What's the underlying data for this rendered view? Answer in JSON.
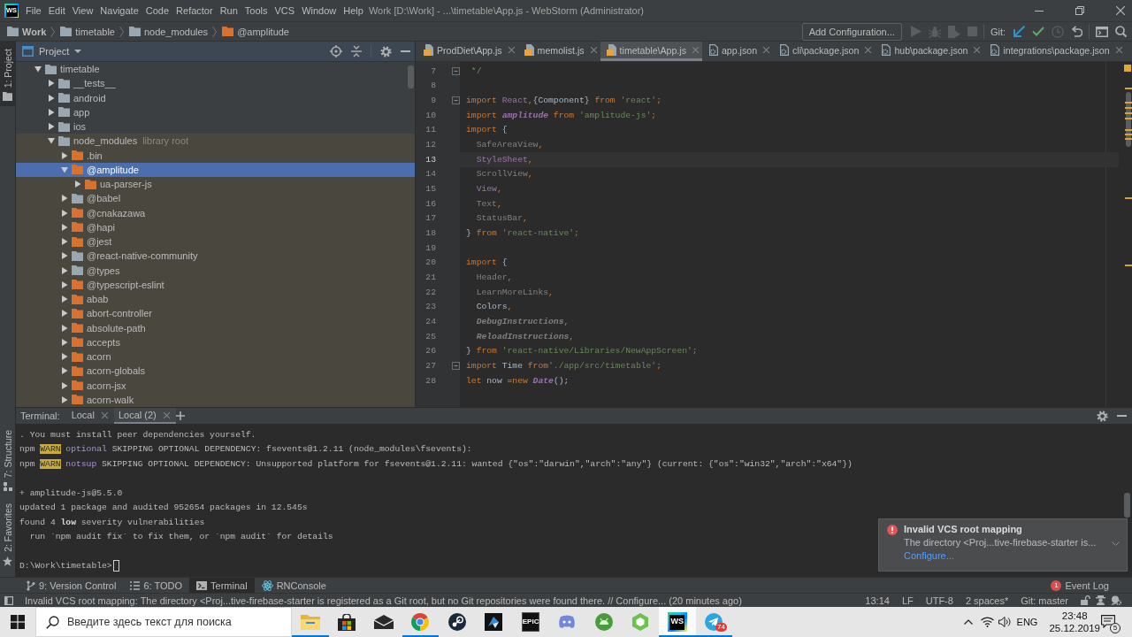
{
  "title_bar": {
    "logo_text": "WS",
    "menu": [
      "File",
      "Edit",
      "View",
      "Navigate",
      "Code",
      "Refactor",
      "Run",
      "Tools",
      "VCS",
      "Window",
      "Help"
    ],
    "title": "Work [D:\\Work] - ...\\timetable\\App.js - WebStorm (Administrator)"
  },
  "navigation_bar": {
    "breadcrumbs": [
      {
        "label": "Work",
        "kind": "project"
      },
      {
        "label": "timetable",
        "kind": "folder"
      },
      {
        "label": "node_modules",
        "kind": "folder"
      },
      {
        "label": "@amplitude",
        "kind": "package"
      }
    ],
    "run_configuration": "Add Configuration...",
    "run_tools": [
      {
        "kind": "run",
        "disabled": true
      },
      {
        "kind": "debug",
        "disabled": true
      },
      {
        "kind": "coverage",
        "disabled": true
      },
      {
        "kind": "stop",
        "disabled": true
      }
    ],
    "vcs_label": "Git:",
    "vcs_tools": [
      {
        "kind": "update",
        "disabled": false
      },
      {
        "kind": "commit",
        "disabled": false
      },
      {
        "kind": "history",
        "disabled": true
      },
      {
        "kind": "rollback",
        "disabled": false
      }
    ]
  },
  "left_stripe": {
    "top": [
      {
        "label": "1: Project",
        "kind": "project",
        "selected": true
      }
    ],
    "bottom": [
      {
        "label": "7: Structure",
        "kind": "structure",
        "selected": false
      },
      {
        "label": "2: Favorites",
        "kind": "favorites",
        "selected": false
      }
    ]
  },
  "project_panel": {
    "title": "Project",
    "tree": [
      {
        "label": "timetable",
        "kind": "folder",
        "expanded": true,
        "selected": false,
        "children": [
          {
            "label": "__tests__",
            "kind": "folder",
            "expanded": false,
            "selected": false
          },
          {
            "label": "android",
            "kind": "folder",
            "expanded": false,
            "selected": false
          },
          {
            "label": "app",
            "kind": "folder",
            "expanded": false,
            "selected": false
          },
          {
            "label": "ios",
            "kind": "folder",
            "expanded": false,
            "selected": false
          },
          {
            "label": "node_modules",
            "kind": "library-root",
            "hint": "library root",
            "expanded": true,
            "selected": false,
            "children": [
              {
                "label": ".bin",
                "kind": "package",
                "expanded": false,
                "selected": false
              },
              {
                "label": "@amplitude",
                "kind": "package",
                "expanded": true,
                "selected": true,
                "children": [
                  {
                    "label": "ua-parser-js",
                    "kind": "package",
                    "expanded": false,
                    "selected": false
                  }
                ]
              },
              {
                "label": "@babel",
                "kind": "folder",
                "expanded": false,
                "selected": false
              },
              {
                "label": "@cnakazawa",
                "kind": "package",
                "expanded": false,
                "selected": false
              },
              {
                "label": "@hapi",
                "kind": "package",
                "expanded": false,
                "selected": false
              },
              {
                "label": "@jest",
                "kind": "package",
                "expanded": false,
                "selected": false
              },
              {
                "label": "@react-native-community",
                "kind": "folder",
                "expanded": false,
                "selected": false
              },
              {
                "label": "@types",
                "kind": "folder",
                "expanded": false,
                "selected": false
              },
              {
                "label": "@typescript-eslint",
                "kind": "package",
                "expanded": false,
                "selected": false
              },
              {
                "label": "abab",
                "kind": "package",
                "expanded": false,
                "selected": false
              },
              {
                "label": "abort-controller",
                "kind": "package",
                "expanded": false,
                "selected": false
              },
              {
                "label": "absolute-path",
                "kind": "package",
                "expanded": false,
                "selected": false
              },
              {
                "label": "accepts",
                "kind": "package",
                "expanded": false,
                "selected": false
              },
              {
                "label": "acorn",
                "kind": "package",
                "expanded": false,
                "selected": false
              },
              {
                "label": "acorn-globals",
                "kind": "package",
                "expanded": false,
                "selected": false
              },
              {
                "label": "acorn-jsx",
                "kind": "package",
                "expanded": false,
                "selected": false
              },
              {
                "label": "acorn-walk",
                "kind": "package",
                "expanded": false,
                "selected": false
              }
            ]
          }
        ]
      }
    ]
  },
  "editor": {
    "tabs": [
      {
        "label": "ProdDiet\\App.js",
        "kind": "script",
        "selected": false
      },
      {
        "label": "memolist.js",
        "kind": "script",
        "selected": false
      },
      {
        "label": "timetable\\App.js",
        "kind": "script",
        "selected": true
      },
      {
        "label": "app.json",
        "kind": "json",
        "selected": false
      },
      {
        "label": "cli\\package.json",
        "kind": "json",
        "selected": false
      },
      {
        "label": "hub\\package.json",
        "kind": "json",
        "selected": false
      },
      {
        "label": "integrations\\package.json",
        "kind": "json",
        "selected": false
      }
    ],
    "lines": [
      {
        "number": "7",
        "current": false,
        "fold": true,
        "tokens": [
          {
            "text": " */",
            "kind": "comment"
          }
        ]
      },
      {
        "number": "8",
        "current": false,
        "fold": false
      },
      {
        "number": "9",
        "current": false,
        "fold": true,
        "tokens": [
          {
            "text": "import ",
            "kind": "keyword"
          },
          {
            "text": "React",
            "kind": "member"
          },
          {
            "text": ",",
            "kind": "keyword"
          },
          {
            "text": "{Component} ",
            "kind": "plain"
          },
          {
            "text": "from ",
            "kind": "keyword"
          },
          {
            "text": "'react'",
            "kind": "string"
          },
          {
            "text": ";",
            "kind": "keyword"
          }
        ]
      },
      {
        "number": "10",
        "current": false,
        "fold": false,
        "tokens": [
          {
            "text": "import ",
            "kind": "keyword"
          },
          {
            "text": "amplitude",
            "kind": "global"
          },
          {
            "text": " from ",
            "kind": "keyword"
          },
          {
            "text": "'amplitude-js'",
            "kind": "string"
          },
          {
            "text": ";",
            "kind": "keyword"
          }
        ]
      },
      {
        "number": "11",
        "current": false,
        "fold": false,
        "tokens": [
          {
            "text": "import ",
            "kind": "keyword"
          },
          {
            "text": "{",
            "kind": "plain"
          }
        ]
      },
      {
        "number": "12",
        "current": false,
        "fold": false,
        "tokens": [
          {
            "text": "  SafeAreaView",
            "kind": "unused"
          },
          {
            "text": ",",
            "kind": "keyword"
          }
        ]
      },
      {
        "number": "13",
        "current": true,
        "fold": false,
        "tokens": [
          {
            "text": "  StyleSheet",
            "kind": "member"
          },
          {
            "text": ",",
            "kind": "keyword"
          }
        ]
      },
      {
        "number": "14",
        "current": false,
        "fold": false,
        "tokens": [
          {
            "text": "  ScrollView",
            "kind": "unused"
          },
          {
            "text": ",",
            "kind": "keyword"
          }
        ]
      },
      {
        "number": "15",
        "current": false,
        "fold": false,
        "tokens": [
          {
            "text": "  View",
            "kind": "member"
          },
          {
            "text": ",",
            "kind": "keyword"
          }
        ]
      },
      {
        "number": "16",
        "current": false,
        "fold": false,
        "tokens": [
          {
            "text": "  Text",
            "kind": "unused"
          },
          {
            "text": ",",
            "kind": "keyword"
          }
        ]
      },
      {
        "number": "17",
        "current": false,
        "fold": false,
        "tokens": [
          {
            "text": "  StatusBar",
            "kind": "unused"
          },
          {
            "text": ",",
            "kind": "keyword"
          }
        ]
      },
      {
        "number": "18",
        "current": false,
        "fold": false,
        "tokens": [
          {
            "text": "} ",
            "kind": "plain"
          },
          {
            "text": "from ",
            "kind": "keyword"
          },
          {
            "text": "'react-native'",
            "kind": "string"
          },
          {
            "text": ";",
            "kind": "keyword"
          }
        ]
      },
      {
        "number": "19",
        "current": false,
        "fold": false
      },
      {
        "number": "20",
        "current": false,
        "fold": false,
        "tokens": [
          {
            "text": "import ",
            "kind": "keyword"
          },
          {
            "text": "{",
            "kind": "plain"
          }
        ]
      },
      {
        "number": "21",
        "current": false,
        "fold": false,
        "tokens": [
          {
            "text": "  Header",
            "kind": "unused"
          },
          {
            "text": ",",
            "kind": "keyword"
          }
        ]
      },
      {
        "number": "22",
        "current": false,
        "fold": false,
        "tokens": [
          {
            "text": "  LearnMoreLinks",
            "kind": "unused"
          },
          {
            "text": ",",
            "kind": "keyword"
          }
        ]
      },
      {
        "number": "23",
        "current": false,
        "fold": false,
        "tokens": [
          {
            "text": "  Colors",
            "kind": "plain"
          },
          {
            "text": ",",
            "kind": "keyword"
          }
        ]
      },
      {
        "number": "24",
        "current": false,
        "fold": false,
        "tokens": [
          {
            "text": "  DebugInstructions",
            "kind": "unused-italic"
          },
          {
            "text": ",",
            "kind": "keyword"
          }
        ]
      },
      {
        "number": "25",
        "current": false,
        "fold": false,
        "tokens": [
          {
            "text": "  ReloadInstructions",
            "kind": "unused-italic"
          },
          {
            "text": ",",
            "kind": "keyword"
          }
        ]
      },
      {
        "number": "26",
        "current": false,
        "fold": false,
        "tokens": [
          {
            "text": "} ",
            "kind": "plain"
          },
          {
            "text": "from ",
            "kind": "keyword"
          },
          {
            "text": "'react-native/Libraries/NewAppScreen'",
            "kind": "string"
          },
          {
            "text": ";",
            "kind": "keyword"
          }
        ]
      },
      {
        "number": "27",
        "current": false,
        "fold": true,
        "tokens": [
          {
            "text": "import ",
            "kind": "keyword"
          },
          {
            "text": "Time ",
            "kind": "plain"
          },
          {
            "text": "from",
            "kind": "keyword"
          },
          {
            "text": "'./app/src/timetable'",
            "kind": "string"
          },
          {
            "text": ";",
            "kind": "keyword"
          }
        ]
      },
      {
        "number": "28",
        "current": false,
        "fold": false,
        "tokens": [
          {
            "text": "let ",
            "kind": "keyword"
          },
          {
            "text": "now =",
            "kind": "plain"
          },
          {
            "text": "new ",
            "kind": "keyword"
          },
          {
            "text": "Date",
            "kind": "global"
          },
          {
            "text": "();",
            "kind": "plain"
          }
        ]
      }
    ]
  },
  "terminal": {
    "label": "Terminal:",
    "tabs": [
      {
        "label": "Local",
        "selected": false
      },
      {
        "label": "Local (2)",
        "selected": true
      }
    ],
    "lines": [
      {
        "kind": "output",
        "tokens": [
          {
            "text": ". You must install peer dependencies yourself.",
            "kind": "plain"
          }
        ]
      },
      {
        "kind": "output",
        "tokens": [
          {
            "text": "npm ",
            "kind": "plain"
          },
          {
            "text": "WARN",
            "kind": "warn"
          },
          {
            "text": " optional",
            "kind": "tag"
          },
          {
            "text": " SKIPPING OPTIONAL DEPENDENCY: fsevents@1.2.11 (node_modules\\fsevents):",
            "kind": "plain"
          }
        ]
      },
      {
        "kind": "output",
        "tokens": [
          {
            "text": "npm ",
            "kind": "plain"
          },
          {
            "text": "WARN",
            "kind": "warn"
          },
          {
            "text": " notsup",
            "kind": "tag"
          },
          {
            "text": " SKIPPING OPTIONAL DEPENDENCY: Unsupported platform for fsevents@1.2.11: wanted {\"os\":\"darwin\",\"arch\":\"any\"} (current: {\"os\":\"win32\",\"arch\":\"x64\"})",
            "kind": "plain"
          }
        ]
      },
      {
        "kind": "blank"
      },
      {
        "kind": "output",
        "tokens": [
          {
            "text": "+ amplitude-js@5.5.0",
            "kind": "plain"
          }
        ]
      },
      {
        "kind": "output",
        "tokens": [
          {
            "text": "updated 1 package and audited 952654 packages in 12.545s",
            "kind": "plain"
          }
        ]
      },
      {
        "kind": "output",
        "tokens": [
          {
            "text": "found 4 ",
            "kind": "plain"
          },
          {
            "text": "low",
            "kind": "bold"
          },
          {
            "text": " severity vulnerabilities",
            "kind": "plain"
          }
        ]
      },
      {
        "kind": "output",
        "tokens": [
          {
            "text": "  run `npm audit fix` to fix them, or `npm audit` for details",
            "kind": "plain"
          }
        ]
      },
      {
        "kind": "blank"
      },
      {
        "kind": "prompt",
        "text": "D:\\Work\\timetable>"
      }
    ]
  },
  "notification": {
    "title": "Invalid VCS root mapping",
    "text": "The directory <Proj...tive-firebase-starter is...",
    "link": "Configure..."
  },
  "tool_window_bar": {
    "tools": [
      {
        "label": "9: Version Control",
        "kind": "vcs",
        "selected": false
      },
      {
        "label": "6: TODO",
        "kind": "todo",
        "selected": false
      },
      {
        "label": "Terminal",
        "kind": "terminal",
        "selected": true
      },
      {
        "label": "RNConsole",
        "kind": "react",
        "selected": false
      }
    ],
    "event_log": {
      "label": "Event Log",
      "badge": "1"
    }
  },
  "status_bar": {
    "message": "Invalid VCS root mapping: The directory <Proj...tive-firebase-starter is registered as a Git root, but no Git repositories were found there. // Configure... (20 minutes ago)",
    "widgets": [
      "13:14",
      "LF",
      "UTF-8",
      "2 spaces*",
      "Git: master"
    ]
  },
  "taskbar": {
    "search": {
      "placeholder": "Введите здесь текст для поиска"
    },
    "apps": [
      {
        "kind": "folder",
        "active": false,
        "running": true
      },
      {
        "kind": "bag",
        "active": false,
        "running": false
      },
      {
        "kind": "envelope",
        "active": false,
        "running": false
      },
      {
        "kind": "segmented",
        "active": false,
        "running": true
      },
      {
        "kind": "disc",
        "active": false,
        "running": false
      },
      {
        "kind": "shape",
        "active": false,
        "running": false
      },
      {
        "kind": "text-tile",
        "text": "EPIC",
        "active": false,
        "running": false
      },
      {
        "kind": "face",
        "active": false,
        "running": false
      },
      {
        "kind": "robot",
        "active": false,
        "running": false
      },
      {
        "kind": "hexagon",
        "active": false,
        "running": false
      },
      {
        "kind": "logo-tile",
        "text": "WS",
        "active": true,
        "running": true
      },
      {
        "kind": "plane",
        "badge": "74",
        "active": false,
        "running": true
      }
    ],
    "tray": {
      "language": "ENG",
      "time": "23:48",
      "date": "25.12.2019",
      "notifications": "5"
    }
  }
}
